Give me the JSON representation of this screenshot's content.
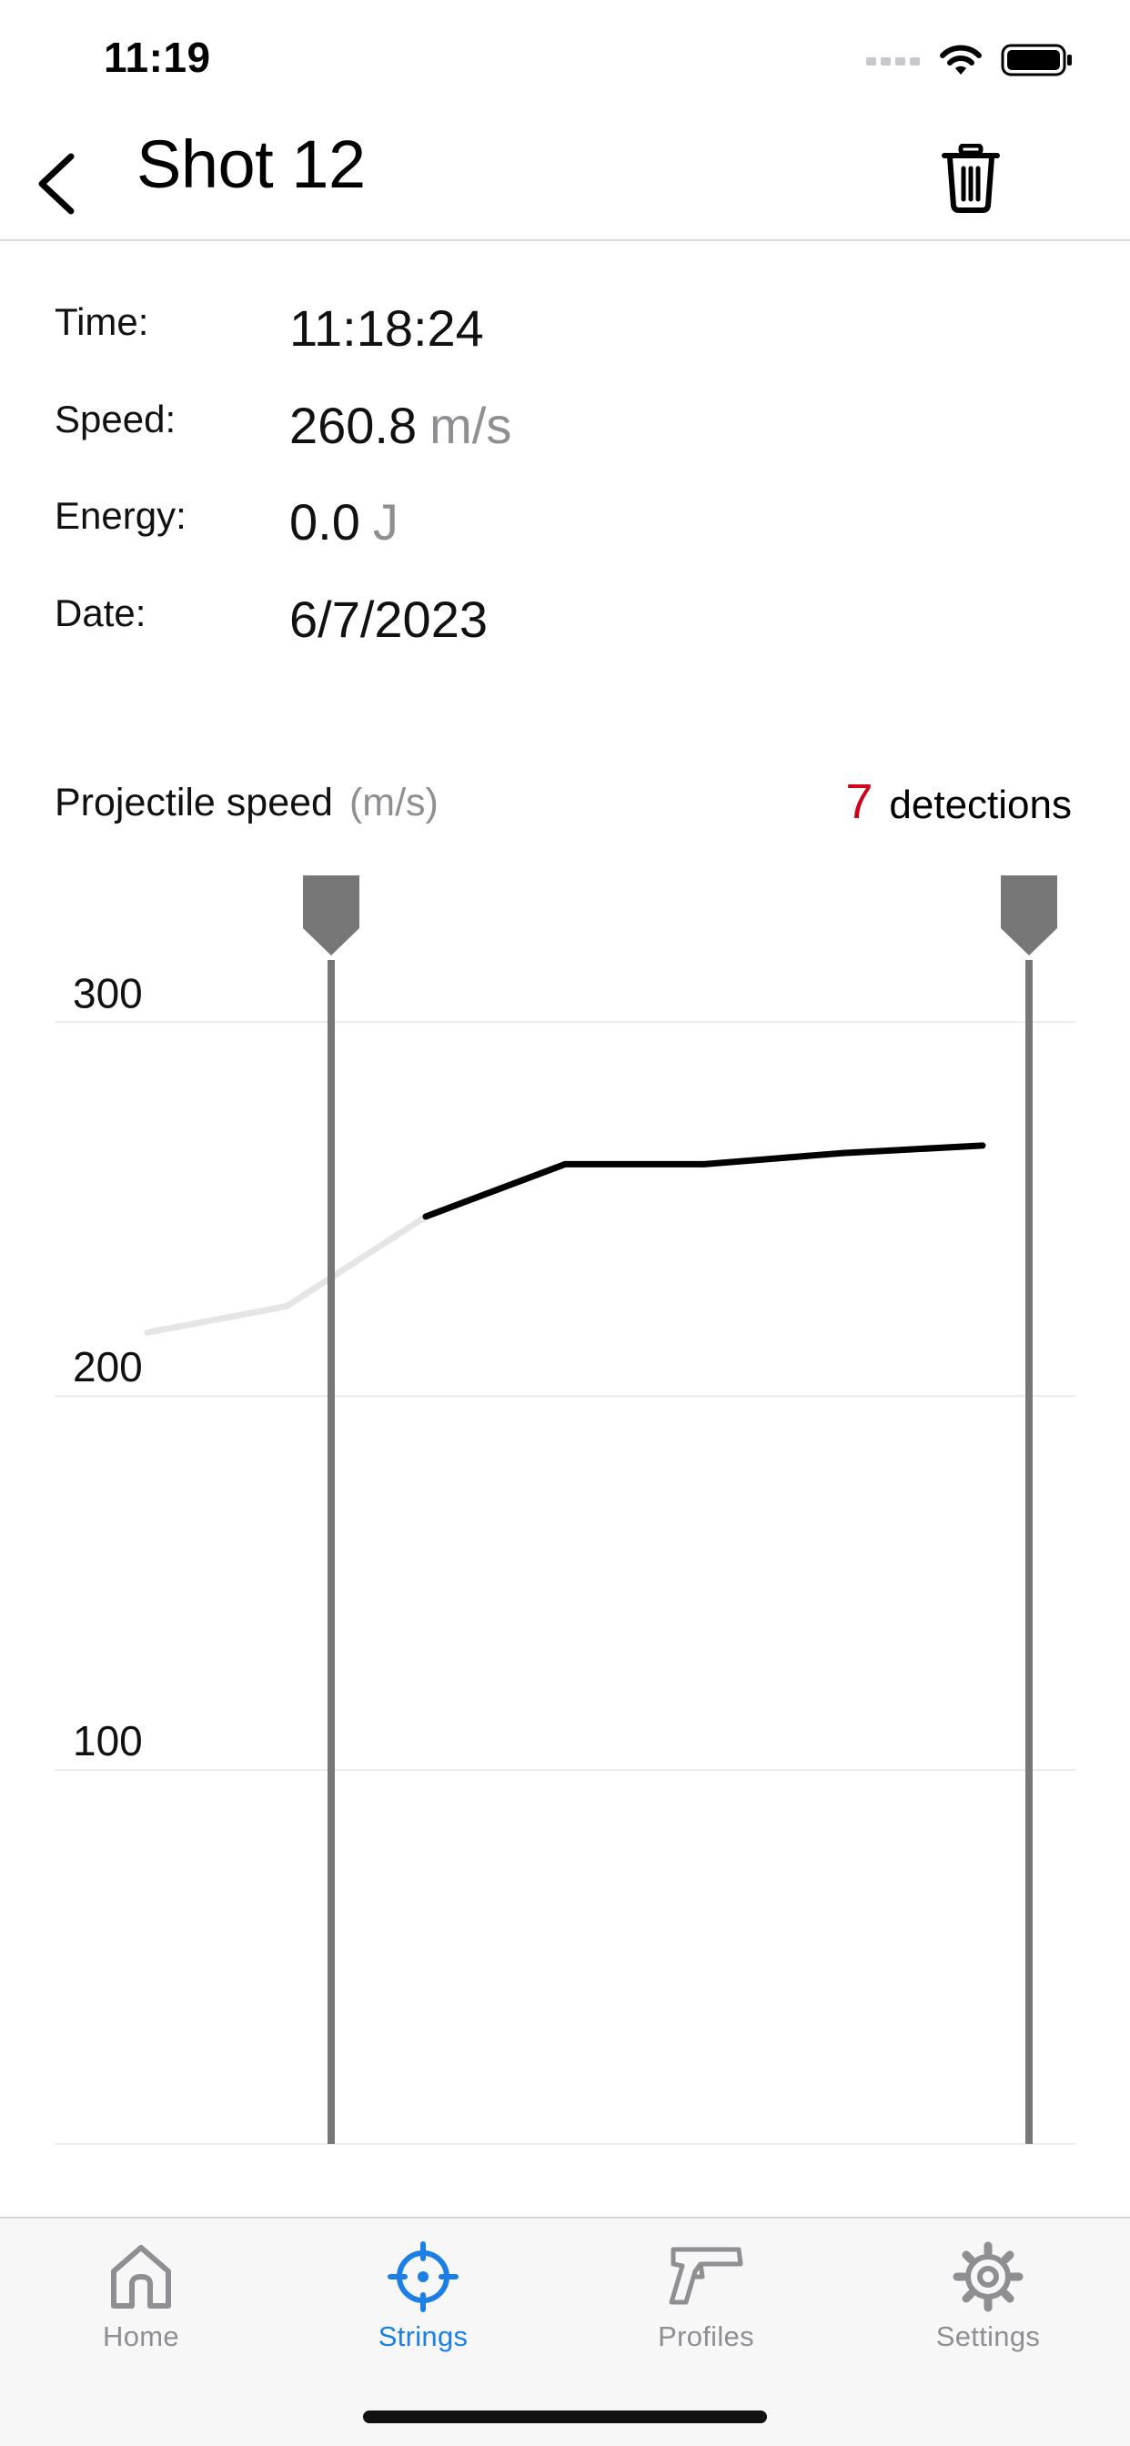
{
  "status_bar": {
    "time": "11:19"
  },
  "nav": {
    "title": "Shot 12"
  },
  "details": [
    {
      "label": "Time:",
      "value": "11:18:24",
      "unit": ""
    },
    {
      "label": "Speed:",
      "value": "260.8",
      "unit": "m/s"
    },
    {
      "label": "Energy:",
      "value": "0.0",
      "unit": "J"
    },
    {
      "label": "Date:",
      "value": "6/7/2023",
      "unit": ""
    }
  ],
  "chart_header": {
    "title": "Projectile speed",
    "unit": "(m/s)",
    "detection_count": "7",
    "detection_label": "detections"
  },
  "chart_data": {
    "type": "line",
    "title": "Projectile speed (m/s)",
    "xlabel": "",
    "ylabel": "",
    "ylim": [
      0,
      330
    ],
    "yticks": [
      100,
      200,
      300
    ],
    "grid": true,
    "x": [
      1,
      2,
      3,
      4,
      5,
      6,
      7
    ],
    "series": [
      {
        "values": [
          217,
          224,
          248,
          262,
          262,
          265,
          267
        ]
      }
    ],
    "selected_range": [
      3,
      7
    ],
    "colors": {
      "selected": "#000000",
      "unselected": "#e5e5e5",
      "marker": "#777777",
      "grid": "#ececec"
    }
  },
  "tabs": [
    {
      "label": "Home",
      "icon": "home-icon",
      "active": false
    },
    {
      "label": "Strings",
      "icon": "crosshair-icon",
      "active": true
    },
    {
      "label": "Profiles",
      "icon": "pistol-icon",
      "active": false
    },
    {
      "label": "Settings",
      "icon": "gear-icon",
      "active": false
    }
  ],
  "colors": {
    "accent": "#1b7fe6",
    "detection_count": "#d0021b",
    "inactive_tab": "#8e8e93"
  }
}
